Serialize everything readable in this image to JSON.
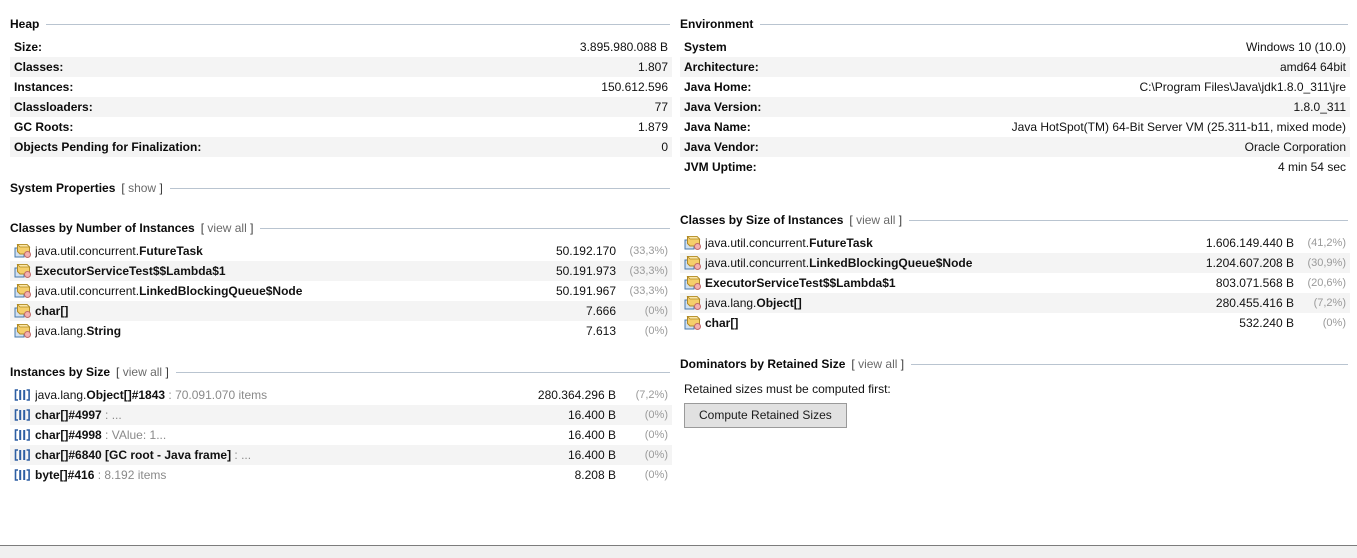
{
  "heap": {
    "title": "Heap",
    "rows": [
      {
        "key": "Size:",
        "value": "3.895.980.088 B"
      },
      {
        "key": "Classes:",
        "value": "1.807"
      },
      {
        "key": "Instances:",
        "value": "150.612.596"
      },
      {
        "key": "Classloaders:",
        "value": "77"
      },
      {
        "key": "GC Roots:",
        "value": "1.879"
      },
      {
        "key": "Objects Pending for Finalization:",
        "value": "0"
      }
    ]
  },
  "environment": {
    "title": "Environment",
    "rows": [
      {
        "key": "System",
        "value": "Windows 10 (10.0)"
      },
      {
        "key": "Architecture:",
        "value": "amd64 64bit"
      },
      {
        "key": "Java Home:",
        "value": "C:\\Program Files\\Java\\jdk1.8.0_311\\jre"
      },
      {
        "key": "Java Version:",
        "value": "1.8.0_311"
      },
      {
        "key": "Java Name:",
        "value": "Java HotSpot(TM) 64-Bit Server VM (25.311-b11, mixed mode)"
      },
      {
        "key": "Java Vendor:",
        "value": "Oracle Corporation"
      },
      {
        "key": "JVM Uptime:",
        "value": "4 min 54 sec"
      }
    ]
  },
  "system_properties": {
    "title": "System Properties",
    "link_open": "[",
    "link_label": "show",
    "link_close": "]"
  },
  "classes_by_count": {
    "title": "Classes by Number of Instances",
    "link_open": "[",
    "link_label": "view all",
    "link_close": "]",
    "icon": "class-icon",
    "rows": [
      {
        "pkg": "java.util.concurrent.",
        "simple": "FutureTask",
        "suffix": "",
        "size": "50.192.170",
        "pct": "(33,3%)"
      },
      {
        "pkg": "",
        "simple": "ExecutorServiceTest$$Lambda$1",
        "suffix": "",
        "size": "50.191.973",
        "pct": "(33,3%)"
      },
      {
        "pkg": "java.util.concurrent.",
        "simple": "LinkedBlockingQueue$Node",
        "suffix": "",
        "size": "50.191.967",
        "pct": "(33,3%)"
      },
      {
        "pkg": "",
        "simple": "char[]",
        "suffix": "",
        "size": "7.666",
        "pct": "(0%)"
      },
      {
        "pkg": "java.lang.",
        "simple": "String",
        "suffix": "",
        "size": "7.613",
        "pct": "(0%)"
      }
    ]
  },
  "classes_by_size": {
    "title": "Classes by Size of Instances",
    "link_open": "[",
    "link_label": "view all",
    "link_close": "]",
    "icon": "class-icon",
    "rows": [
      {
        "pkg": "java.util.concurrent.",
        "simple": "FutureTask",
        "suffix": "",
        "size": "1.606.149.440 B",
        "pct": "(41,2%)"
      },
      {
        "pkg": "java.util.concurrent.",
        "simple": "LinkedBlockingQueue$Node",
        "suffix": "",
        "size": "1.204.607.208 B",
        "pct": "(30,9%)"
      },
      {
        "pkg": "",
        "simple": "ExecutorServiceTest$$Lambda$1",
        "suffix": "",
        "size": "803.071.568 B",
        "pct": "(20,6%)"
      },
      {
        "pkg": "java.lang.",
        "simple": "Object[]",
        "suffix": "",
        "size": "280.455.416 B",
        "pct": "(7,2%)"
      },
      {
        "pkg": "",
        "simple": "char[]",
        "suffix": "",
        "size": "532.240 B",
        "pct": "(0%)"
      }
    ]
  },
  "instances_by_size": {
    "title": "Instances by Size",
    "link_open": "[",
    "link_label": "view all",
    "link_close": "]",
    "icon": "array-icon",
    "rows": [
      {
        "pkg": "java.lang.",
        "simple": "Object[]#1843",
        "suffix": " : 70.091.070 items",
        "size": "280.364.296 B",
        "pct": "(7,2%)"
      },
      {
        "pkg": "",
        "simple": "char[]#4997",
        "suffix": " : ...",
        "size": "16.400 B",
        "pct": "(0%)"
      },
      {
        "pkg": "",
        "simple": "char[]#4998",
        "suffix": " : VAlue: 1...",
        "size": "16.400 B",
        "pct": "(0%)"
      },
      {
        "pkg": "",
        "simple": "char[]#6840 [GC root - Java frame]",
        "suffix": " : ...",
        "size": "16.400 B",
        "pct": "(0%)"
      },
      {
        "pkg": "",
        "simple": "byte[]#416",
        "suffix": " : 8.192 items",
        "size": "8.208 B",
        "pct": "(0%)"
      }
    ]
  },
  "dominators": {
    "title": "Dominators by Retained Size",
    "link_open": "[",
    "link_label": "view all",
    "link_close": "]",
    "note": "Retained sizes must be computed first:",
    "button_label": "Compute Retained Sizes"
  },
  "colors": {
    "rule": "#b9c4d0",
    "row_alt": "#f4f4f4",
    "percent_text": "#9a9a9a",
    "class_icon_yellow": "#f5cf6b",
    "class_icon_blue": "#9fc3e8",
    "class_icon_pink": "#f0a7a7",
    "array_icon_blue": "#2e5fa3",
    "button_face": "#e1e1e1"
  }
}
